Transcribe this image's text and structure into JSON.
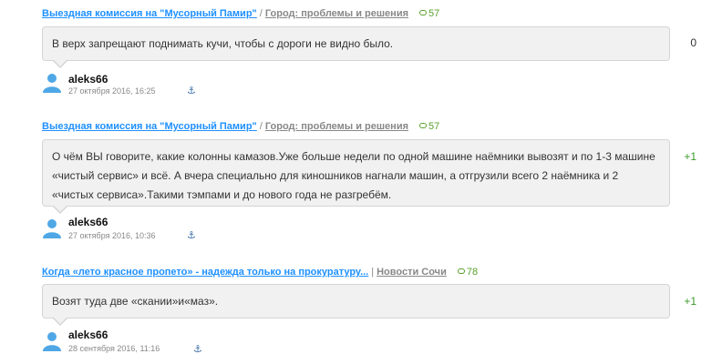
{
  "comments": [
    {
      "topic": "Выездная комиссия на \"Мусорный Памир\"",
      "separator": "/",
      "category": "Город: проблемы и решения",
      "count": "57",
      "text": "В верх запрещают поднимать кучи, чтобы с дороги не видно было.",
      "rating": "0",
      "author": "aleks66",
      "date": "27 октября 2016, 16:25",
      "anchor_icon": "anchor-icon"
    },
    {
      "topic": "Выездная комиссия на \"Мусорный Памир\"",
      "separator": "/",
      "category": "Город: проблемы и решения",
      "count": "57",
      "text": "О чём ВЫ говорите, какие колонны камазов.Уже больше недели по одной машине наёмники вывозят и по 1-3 машине «чистый сервис» и всё. А вчера специально для киношников нагнали машин, а отгрузили всего 2 наёмника и 2 «чистых сервиса».Такими тэмпами и до нового года не разгребём.",
      "rating": "+1",
      "author": "aleks66",
      "date": "27 октября 2016, 10:36",
      "anchor_icon": "anchor-icon"
    },
    {
      "topic": "Когда «лето красное пропето» - надежда только на прокуратуру...",
      "separator": "|",
      "category": "Новости Сочи",
      "count": "78",
      "text": "Возят туда две «скании»и«маз».",
      "rating": "+1",
      "author": "aleks66",
      "date": "28 сентября 2016, 11:16",
      "anchor_icon": "anchor-icon"
    }
  ],
  "colors": {
    "link": "#1e90ff",
    "count": "#5aa02c",
    "bubble_bg": "#f1f1f1",
    "positive_rating": "#3c9a2c"
  }
}
